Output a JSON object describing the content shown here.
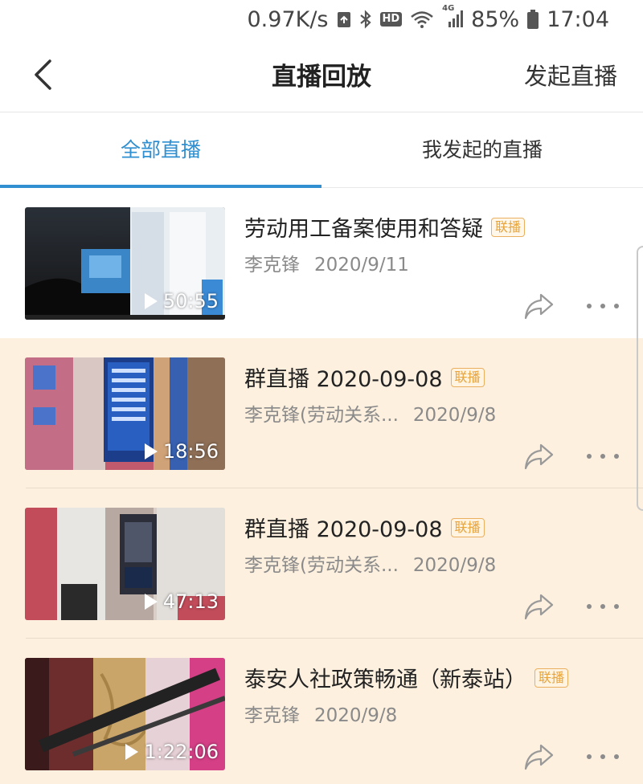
{
  "status_bar": {
    "net_speed": "0.97K/s",
    "hd": "HD",
    "network": "4G",
    "battery": "85%",
    "time": "17:04"
  },
  "header": {
    "title": "直播回放",
    "action_label": "发起直播"
  },
  "tabs": [
    {
      "label": "全部直播",
      "active": true
    },
    {
      "label": "我发起的直播",
      "active": false
    }
  ],
  "items": [
    {
      "title": "劳动用工备案使用和答疑",
      "badge": "联播",
      "author": "李克锋",
      "date": "2020/9/11",
      "duration": "50:55",
      "highlighted": false
    },
    {
      "title": "群直播 2020-09-08",
      "badge": "联播",
      "author": "李克锋(劳动关系...",
      "date": "2020/9/8",
      "duration": "18:56",
      "highlighted": true
    },
    {
      "title": "群直播 2020-09-08",
      "badge": "联播",
      "author": "李克锋(劳动关系...",
      "date": "2020/9/8",
      "duration": "47:13",
      "highlighted": true
    },
    {
      "title": "泰安人社政策畅通（新泰站）",
      "badge": "联播",
      "author": "李克锋",
      "date": "2020/9/8",
      "duration": "1:22:06",
      "highlighted": true
    }
  ],
  "colors": {
    "accent": "#2f8fd0",
    "badge": "#e8a33a",
    "highlight_row": "#fdf0df"
  }
}
